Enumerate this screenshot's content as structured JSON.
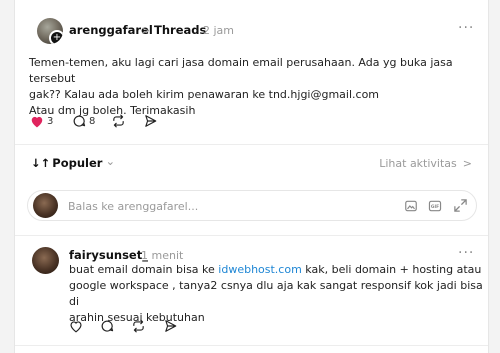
{
  "post": {
    "username": "arenggafarel",
    "separator": ">",
    "community": "Threads",
    "time": "2 jam",
    "more": "···",
    "body_lines": [
      "Temen-temen, aku lagi cari jasa domain email perusahaan. Ada yg buka jasa tersebut",
      "gak?? Kalau ada boleh kirim penawaran ke tnd.hjgi@gmail.com",
      "Atau dm jg boleh. Terimakasih"
    ],
    "likes": "3",
    "comments": "8"
  },
  "sort": {
    "label": "Populer",
    "arrows": "↓↑",
    "caret": "⌄",
    "activity": "Lihat aktivitas",
    "activity_arrow": ">"
  },
  "reply": {
    "placeholder": "Balas ke arenggafarel..."
  },
  "comment": {
    "username": "fairysunset_",
    "time": "1 menit",
    "more": "···",
    "line1_prefix": "buat email domain bisa ke ",
    "line1_link": "idwebhost.com",
    "line1_suffix": " kak, beli domain + hosting atau",
    "line2": "google workspace , tanya2 csnya dlu aja kak sangat responsif kok jadi bisa di",
    "line3": "arahin sesuai kebutuhan"
  },
  "colors": {
    "accent_like": "#e0245e",
    "link": "#1e86d4"
  },
  "icons": [
    "heart-icon",
    "comment-icon",
    "repost-icon",
    "share-icon",
    "image-icon",
    "gif-icon",
    "expand-icon"
  ]
}
